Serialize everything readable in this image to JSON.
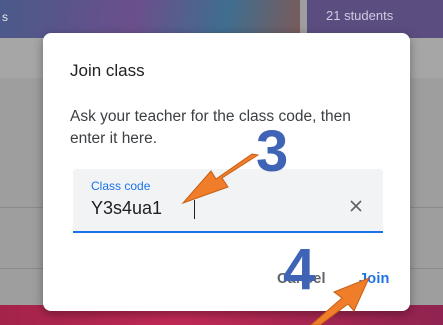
{
  "background": {
    "card_left_text": "s",
    "card_right_text": "21 students"
  },
  "dialog": {
    "title": "Join class",
    "description": "Ask your teacher for the class code, then enter it here.",
    "field": {
      "label": "Class code",
      "value": "Y3s4ua1",
      "clear_icon": "close-icon"
    },
    "actions": {
      "cancel_label": "Cancel",
      "join_label": "Join"
    }
  },
  "annotations": {
    "step_a": "3",
    "step_b": "4",
    "arrow_color": "#f07d2a",
    "number_color": "#3f63b5"
  },
  "colors": {
    "accent": "#1a73e8",
    "bottom_strip": "#c22a55"
  }
}
